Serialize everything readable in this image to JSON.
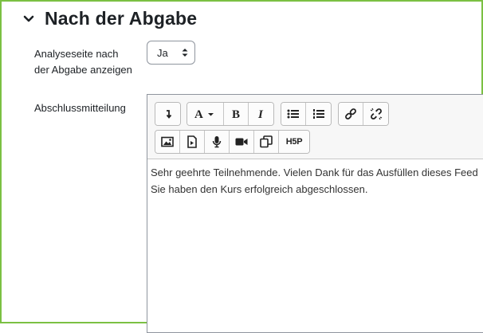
{
  "section": {
    "title": "Nach der Abgabe",
    "icon": "chevron-down-icon"
  },
  "fields": {
    "analysis_label_line1": "Analyseseite nach",
    "analysis_label_line2": "der Abgabe anzeigen",
    "analysis_value": "Ja",
    "message_label": "Abschlussmitteilung"
  },
  "toolbar": {
    "buttons": [
      {
        "name": "paragraph-icon"
      },
      {
        "name": "font-style-icon"
      },
      {
        "name": "bold-icon"
      },
      {
        "name": "italic-icon"
      },
      {
        "name": "unordered-list-icon"
      },
      {
        "name": "ordered-list-icon"
      },
      {
        "name": "link-icon"
      },
      {
        "name": "unlink-icon"
      },
      {
        "name": "image-icon"
      },
      {
        "name": "media-icon"
      },
      {
        "name": "audio-icon"
      },
      {
        "name": "video-icon"
      },
      {
        "name": "manage-files-icon"
      },
      {
        "name": "h5p-icon"
      }
    ],
    "h5p_label": "H5P"
  },
  "editor": {
    "line1": "Sehr geehrte Teilnehmende. Vielen Dank für das Ausfüllen dieses Feed",
    "line2": "Sie haben den Kurs erfolgreich abgeschlossen."
  },
  "colors": {
    "frame": "#7bc043",
    "text": "#1d2125"
  }
}
